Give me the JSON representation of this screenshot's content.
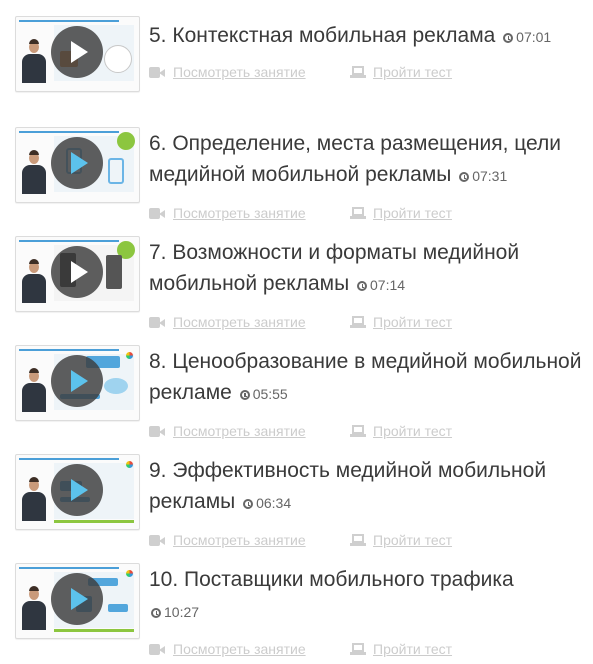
{
  "lessons": [
    {
      "title": "5. Контекстная мобильная реклама",
      "duration": "07:01",
      "watch_label": "Посмотреть занятие",
      "test_label": "Пройти тест"
    },
    {
      "title": "6. Определение, места размещения, цели медийной мобильной рекламы",
      "duration": "07:31",
      "watch_label": "Посмотреть занятие",
      "test_label": "Пройти тест"
    },
    {
      "title": "7. Возможности и форматы медийной мобильной рекламы",
      "duration": "07:14",
      "watch_label": "Посмотреть занятие",
      "test_label": "Пройти тест"
    },
    {
      "title": "8. Ценообразование в медийной мобильной рекламе",
      "duration": "05:55",
      "watch_label": "Посмотреть занятие",
      "test_label": "Пройти тест"
    },
    {
      "title": "9. Эффективность медийной мобильной рекламы",
      "duration": "06:34",
      "watch_label": "Посмотреть занятие",
      "test_label": "Пройти тест"
    },
    {
      "title": "10. Поставщики мобильного трафика",
      "duration": "10:27",
      "watch_label": "Посмотреть занятие",
      "test_label": "Пройти тест"
    }
  ],
  "icons": {
    "play": "play-icon",
    "clock": "clock-icon",
    "video": "video-camera-icon",
    "test": "laptop-icon"
  },
  "colors": {
    "text": "#3a3a3a",
    "muted_link": "#cccccc",
    "play_overlay": "#3c3c3c",
    "accent_blue": "#4b9fd8",
    "accent_green": "#8cc63f"
  }
}
